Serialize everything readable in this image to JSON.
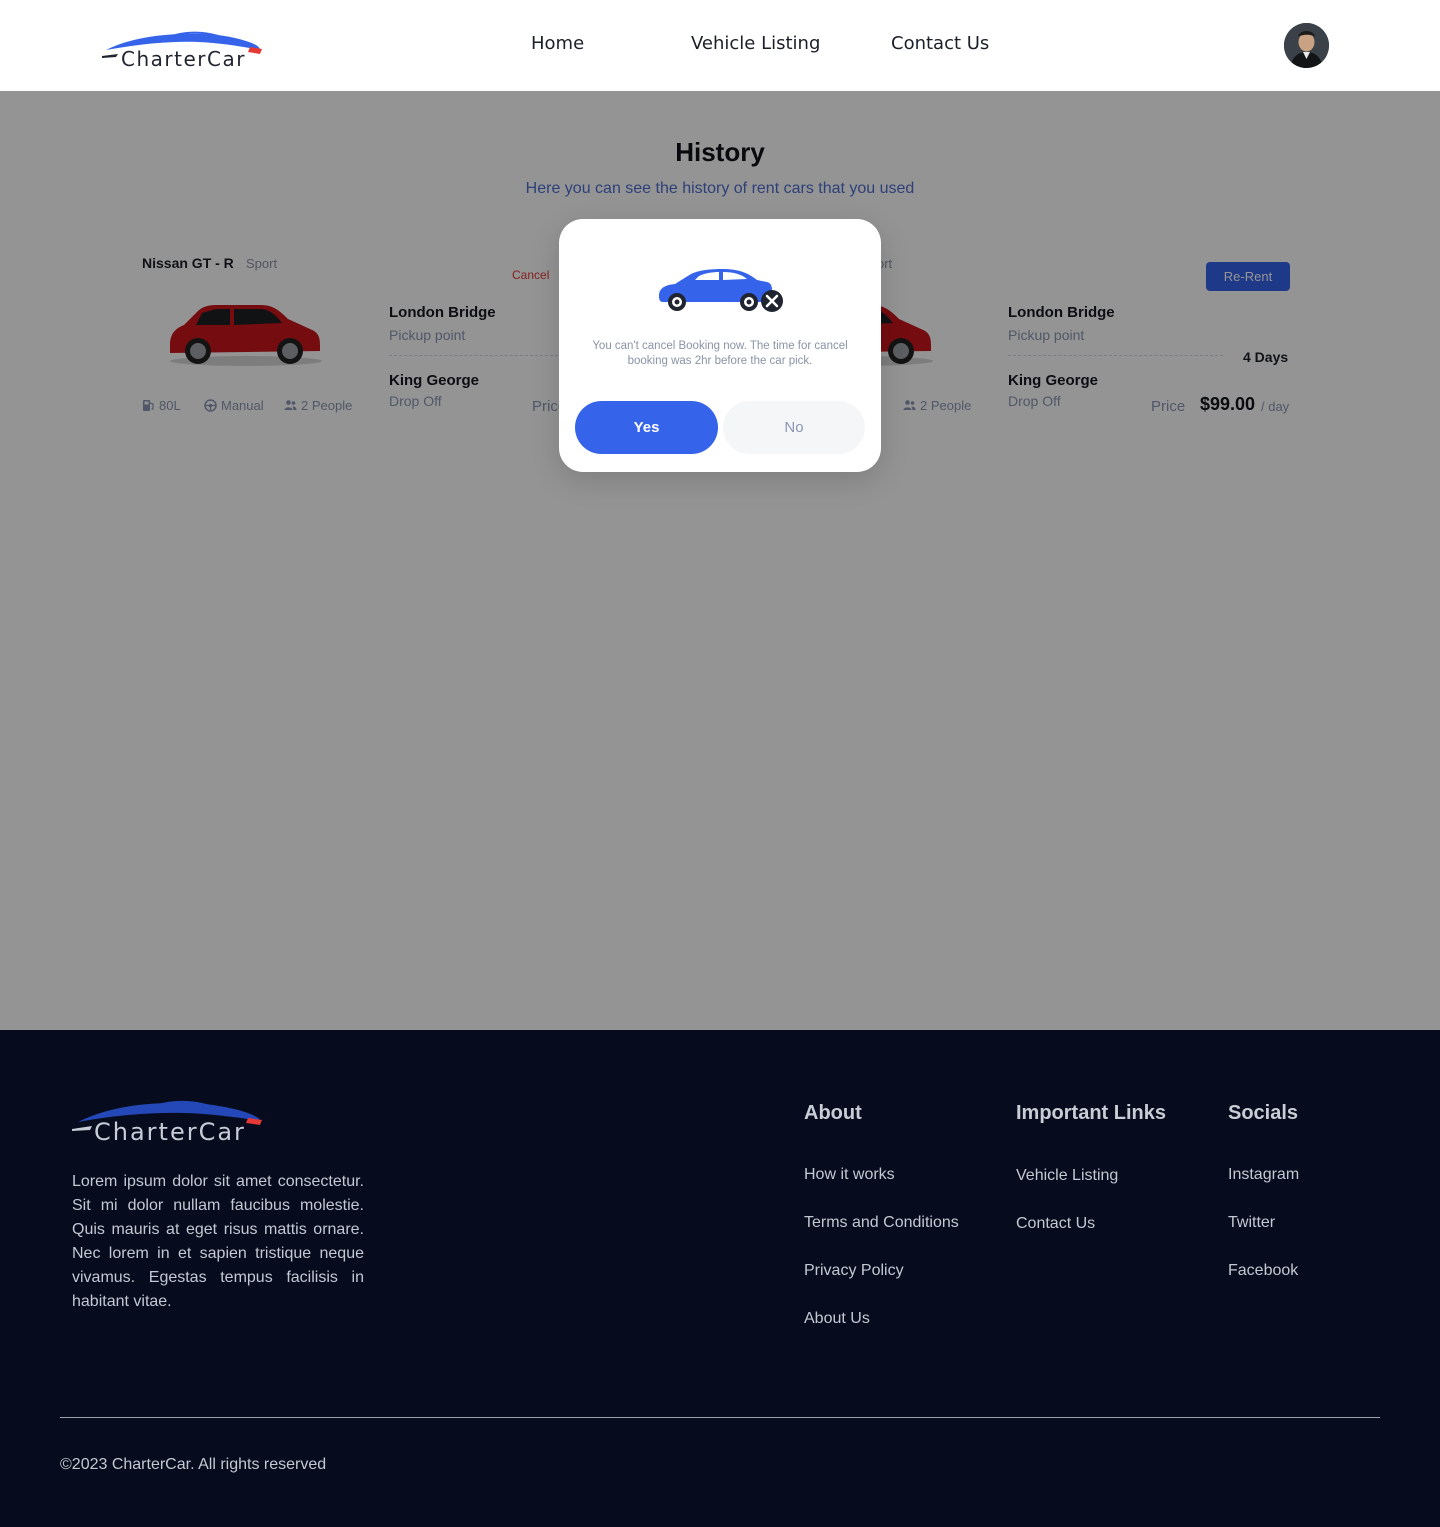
{
  "header": {
    "logo_text": "CharterCar",
    "nav": [
      "Home",
      "Vehicle Listing",
      "Contact Us"
    ]
  },
  "page": {
    "title": "History",
    "subtitle": "Here you can see the history of rent cars that you used"
  },
  "cards": [
    {
      "name": "Nissan GT - R",
      "type": "Sport",
      "action": "Cancel",
      "specs": {
        "fuel": "80L",
        "transmission": "Manual",
        "capacity": "2 People"
      },
      "pickup": {
        "place": "London Bridge",
        "label": "Pickup point"
      },
      "dropoff": {
        "place": "King George",
        "label": "Drop Off"
      },
      "price_label": "Price"
    },
    {
      "type_partial": "ort",
      "action": "Re-Rent",
      "specs": {
        "capacity": "2 People"
      },
      "pickup": {
        "place": "London Bridge",
        "label": "Pickup point"
      },
      "dropoff": {
        "place": "King George",
        "label": "Drop Off"
      },
      "duration": "4 Days",
      "price_label": "Price",
      "price": "$99.00",
      "price_unit": "/ day"
    }
  ],
  "modal": {
    "message": "You can't cancel Booking now. The time for cancel booking was 2hr before the car pick.",
    "yes_label": "Yes",
    "no_label": "No"
  },
  "footer": {
    "logo_text": "CharterCar",
    "description": "Lorem ipsum dolor sit amet consectetur. Sit mi dolor nullam faucibus molestie. Quis mauris at eget risus mattis ornare. Nec lorem in et sapien tristique neque vivamus. Egestas tempus facilisis in habitant vitae.",
    "about": {
      "heading": "About",
      "links": [
        "How it works",
        "Terms and Conditions",
        "Privacy Policy",
        "About Us"
      ]
    },
    "important": {
      "heading": "Important Links",
      "links": [
        "Vehicle Listing",
        "Contact Us"
      ]
    },
    "socials": {
      "heading": "Socials",
      "links": [
        "Instagram",
        "Twitter",
        "Facebook"
      ]
    },
    "copyright": "©2023 CharterCar. All rights reserved"
  },
  "colors": {
    "accent": "#3563e9",
    "footer_bg": "#060c1d",
    "cancel": "#e53935",
    "muted": "#8b96b3"
  }
}
